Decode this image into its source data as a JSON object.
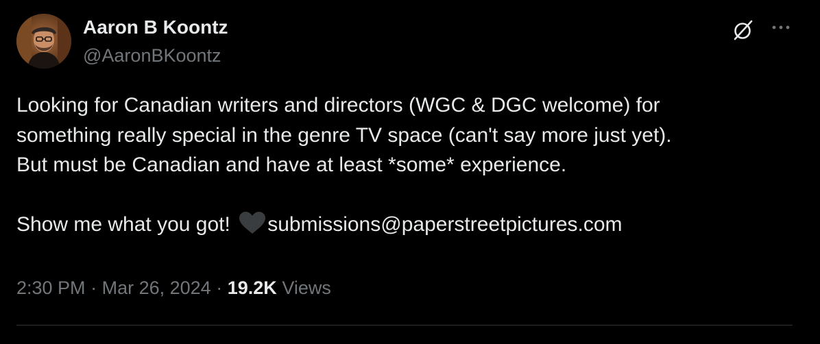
{
  "author": {
    "display_name": "Aaron B Koontz",
    "handle": "@AaronBKoontz",
    "avatar_icon": "user-avatar-photo"
  },
  "actions": {
    "grok_icon": "grok-slash-circle-icon",
    "more_icon": "more-horizontal-icon"
  },
  "tweet": {
    "line1": "Looking for Canadian writers and directors (WGC & DGC welcome) for",
    "line2": "something really special in the genre TV space (can't say more just yet).",
    "line3": "But must be Canadian and have at least *some* experience.",
    "line4_prefix": "Show me what you got!",
    "line4_email": "submissions@paperstreetpictures.com",
    "emoji": "black-heart-emoji"
  },
  "meta": {
    "time": "2:30 PM",
    "separator": "·",
    "date": "Mar 26, 2024",
    "views_count": "19.2K",
    "views_label": "Views"
  },
  "colors": {
    "background": "#000000",
    "text_primary": "#e7e9ea",
    "text_secondary": "#71767b",
    "divider": "#2f3336"
  }
}
